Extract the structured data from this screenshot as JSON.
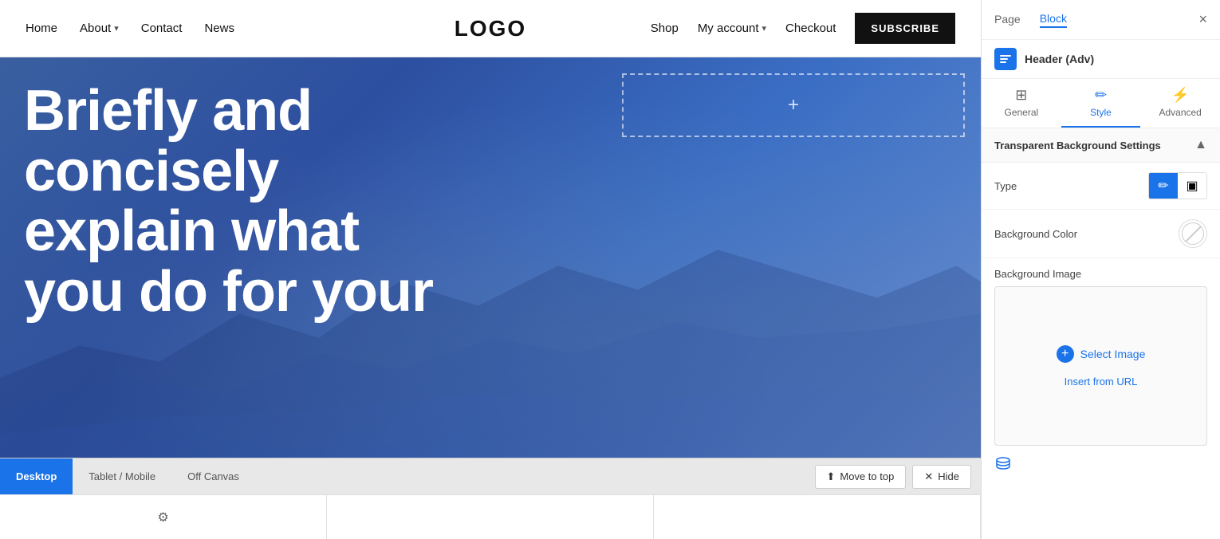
{
  "nav": {
    "home": "Home",
    "about": "About",
    "contact": "Contact",
    "news": "News",
    "logo": "LOGO",
    "shop": "Shop",
    "my_account": "My account",
    "checkout": "Checkout",
    "subscribe": "SUBSCRIBE"
  },
  "hero": {
    "heading_line1": "Briefly and",
    "heading_line2": "concisely",
    "heading_line3": "explain what",
    "heading_line4": "you do for your"
  },
  "toolbar": {
    "desktop": "Desktop",
    "tablet_mobile": "Tablet / Mobile",
    "off_canvas": "Off Canvas",
    "move_to_top": "Move to top",
    "hide": "Hide"
  },
  "sidebar": {
    "tab_page": "Page",
    "tab_block": "Block",
    "close_label": "×",
    "block_label": "Header (Adv)",
    "style_tabs": {
      "general": "General",
      "style": "Style",
      "advanced": "Advanced"
    },
    "section_title": "Transparent Background Settings",
    "type_label": "Type",
    "bg_color_label": "Background Color",
    "bg_image_label": "Background Image",
    "select_image": "Select Image",
    "insert_from_url": "Insert from URL"
  }
}
